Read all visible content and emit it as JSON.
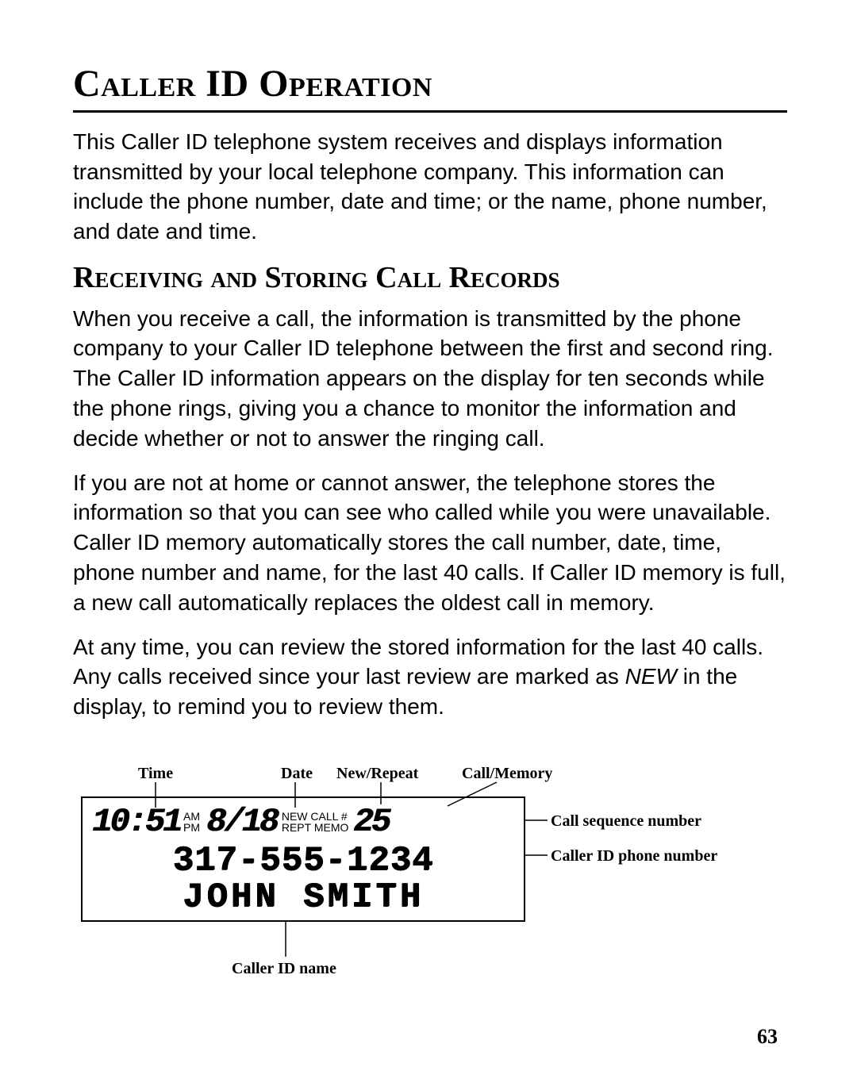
{
  "title": "Caller ID Operation",
  "intro": "This Caller ID telephone system receives and displays information transmitted by your local telephone company. This information can include the phone number, date and time; or the name, phone number, and date and time.",
  "sub_heading": "Receiving and Storing Call Records",
  "para2": "When you receive a call, the information is transmitted by the phone company to your Caller ID telephone between the first and second ring. The Caller ID information appears on the display for ten seconds while the phone rings, giving you a chance to monitor the information and decide whether or not to answer the ringing call.",
  "para3": "If you are not at home or cannot answer, the telephone stores the information so that you can see who called while you were unavailable. Caller ID memory automatically stores the call number, date, time, phone number and name, for the last 40 calls. If Caller ID memory is full, a new call automatically replaces the oldest call in memory.",
  "para4_before": "At any time, you can review the stored information for the last 40 calls. Any calls received since your last review are marked as ",
  "para4_new": "NEW",
  "para4_after": " in the display, to remind you to review them.",
  "page_number": "63",
  "diagram": {
    "labels": {
      "time": "Time",
      "date": "Date",
      "new_repeat": "New/Repeat",
      "call_memory": "Call/Memory",
      "call_sequence": "Call sequence number",
      "caller_id_phone": "Caller ID phone number",
      "caller_id_name": "Caller ID name"
    },
    "lcd": {
      "time": "10:51",
      "am": "AM",
      "pm": "PM",
      "date": "8/18",
      "new_line": "NEW",
      "call_num_label": "CALL #",
      "rept": "REPT",
      "memo": "MEMO",
      "sequence": "25",
      "phone": "317-555-1234",
      "name": "JOHN SMITH"
    }
  }
}
